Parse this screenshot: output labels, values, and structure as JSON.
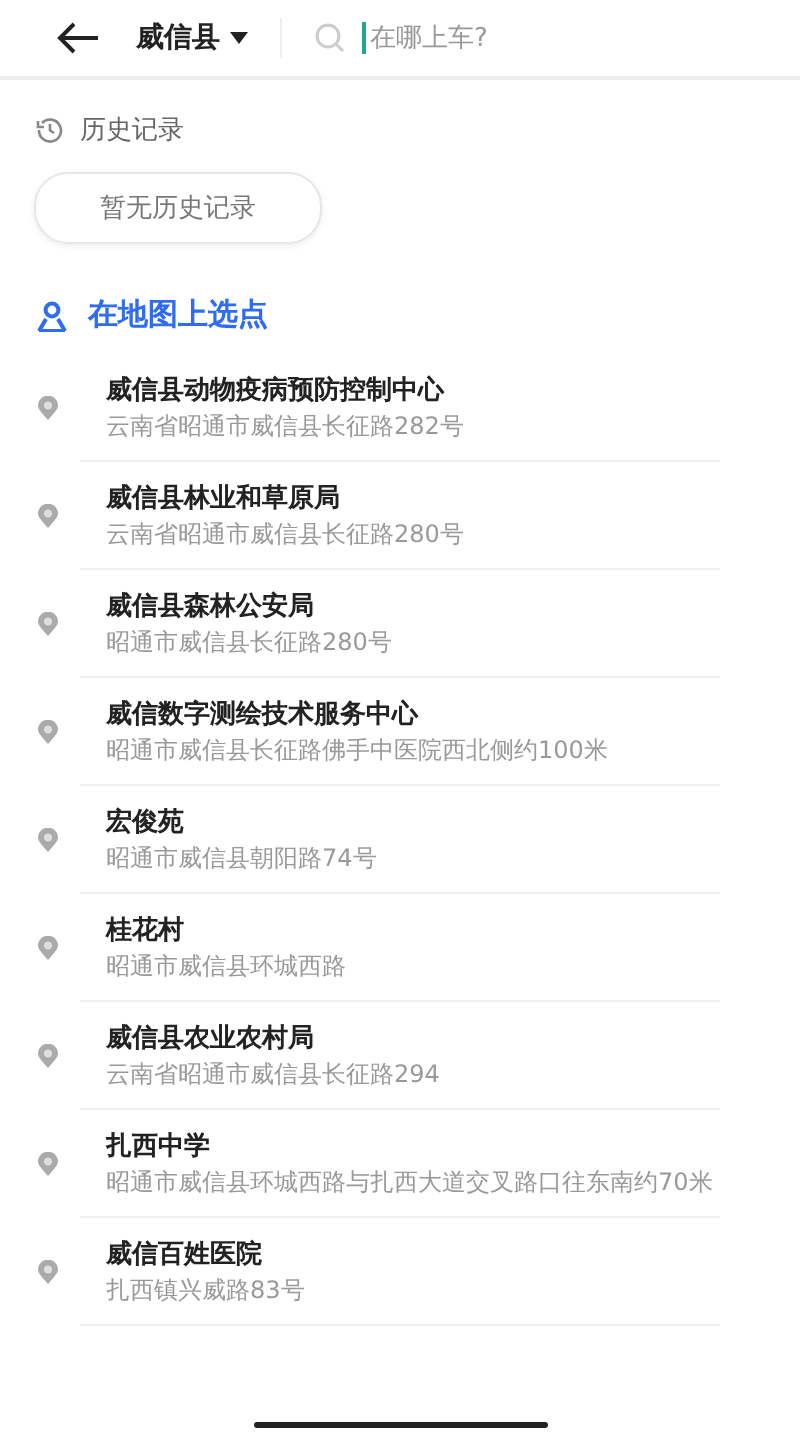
{
  "header": {
    "city": "威信县",
    "search": {
      "placeholder": "在哪上车?"
    }
  },
  "history": {
    "title": "历史记录",
    "empty": "暂无历史记录"
  },
  "map_pick": {
    "label": "在地图上选点"
  },
  "places": [
    {
      "name": "威信县动物疫病预防控制中心",
      "address": "云南省昭通市威信县长征路282号"
    },
    {
      "name": "威信县林业和草原局",
      "address": "云南省昭通市威信县长征路280号"
    },
    {
      "name": "威信县森林公安局",
      "address": "昭通市威信县长征路280号"
    },
    {
      "name": "威信数字测绘技术服务中心",
      "address": "昭通市威信县长征路佛手中医院西北侧约100米"
    },
    {
      "name": "宏俊苑",
      "address": "昭通市威信县朝阳路74号"
    },
    {
      "name": "桂花村",
      "address": "昭通市威信县环城西路"
    },
    {
      "name": "威信县农业农村局",
      "address": "云南省昭通市威信县长征路294"
    },
    {
      "name": "扎西中学",
      "address": "昭通市威信县环城西路与扎西大道交叉路口往东南约70米"
    },
    {
      "name": "威信百姓医院",
      "address": "扎西镇兴威路83号"
    }
  ]
}
